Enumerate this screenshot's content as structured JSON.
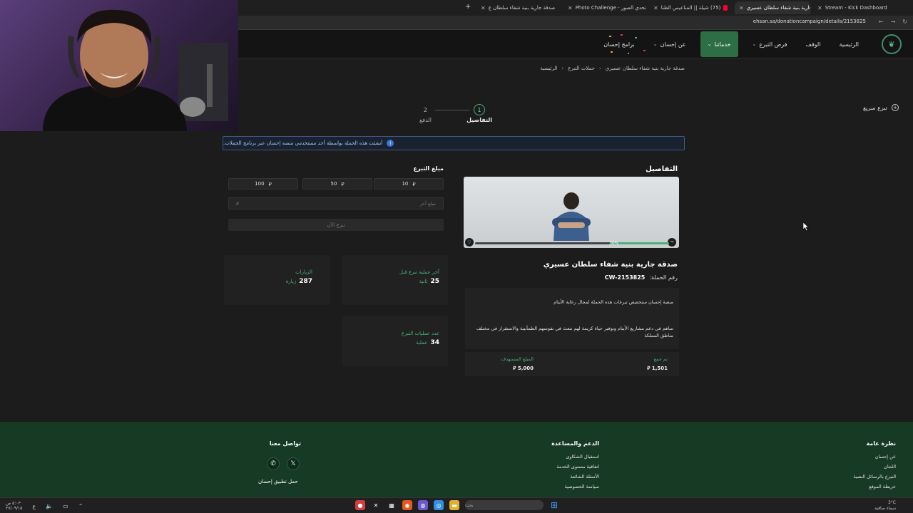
{
  "browser": {
    "tabs": [
      {
        "title": "Stream - Kick Dashboard",
        "active": false,
        "color": "#53fc18"
      },
      {
        "title": "صدقة جارية بنية شفاء سلطان عسيري",
        "active": true,
        "color": "#3f8f6a"
      },
      {
        "title": "(75) شيلة || المناعيس الطنا",
        "active": false,
        "color": "#ff0033"
      },
      {
        "title": "تحدي الصور - Photo Challenge",
        "active": false,
        "color": "#f5c518"
      },
      {
        "title": "صدقة جارية بنية شفاء سلطان ع",
        "active": false,
        "color": "#3f8f6a"
      }
    ],
    "url": "ehsan.sa/donationcampaign/details/2153825"
  },
  "nav": {
    "items": [
      {
        "label": "الرئيسية",
        "dropdown": false,
        "active": false
      },
      {
        "label": "الوقف",
        "dropdown": false,
        "active": false
      },
      {
        "label": "فرص التبرع",
        "dropdown": true,
        "active": false
      },
      {
        "label": "خدماتنا",
        "dropdown": true,
        "active": true
      },
      {
        "label": "عن إحسان",
        "dropdown": true,
        "active": false
      },
      {
        "label": "برامج إحسان",
        "dropdown": false,
        "active": false
      }
    ]
  },
  "breadcrumb": [
    "الرئيسية",
    "حملات التبرع",
    "صدقة جارية بنية شفاء سلطان عسيري"
  ],
  "quick_donate": "تبرع سريع",
  "stepper": {
    "steps": [
      {
        "num": "1",
        "label": "التفاصيل"
      },
      {
        "num": "2",
        "label": "الدفع"
      }
    ]
  },
  "banner": "أنشئت هذه الحملة بواسطة أحد مستخدمي منصة إحسان عبر برنامج الحملات.",
  "details": {
    "title": "التفاصيل",
    "progress_percent": 30,
    "progress_label": "30%",
    "campaign_name": "صدقة جارية بنية شفاء سلطان عسيري",
    "campaign_no_label": "رقم الحملة:",
    "campaign_no": "CW-2153825",
    "desc1": "منصة إحسان ستخصص تبرعات هذه الحملة لمجال رعاية الأيتام",
    "desc2": "ساهم في دعم مشاريع الأيتام وتوفير حياة كريمة لهم تبعث في نفوسهم الطمأنينة والاستقرار في مختلف مناطق المملكة",
    "collected_label": "تم جمع",
    "collected_value": "1,501",
    "target_label": "المبلغ المستهدف",
    "target_value": "5,000",
    "currency": "⃁"
  },
  "donate": {
    "title": "مبلغ التبرع",
    "amounts": [
      "10",
      "50",
      "100"
    ],
    "other_placeholder": "مبلغ آخر",
    "button": "تبرع الآن"
  },
  "stats": {
    "last_donation_label": "آخر عملية تبرع قبل",
    "last_donation_value": "25",
    "last_donation_unit": "ثانية",
    "visits_label": "الزيارات",
    "visits_value": "287",
    "visits_unit": "زيارة",
    "count_label": "عدد عمليات التبرع",
    "count_value": "34",
    "count_unit": "عملية"
  },
  "footer": {
    "overview_title": "نظرة عامة",
    "overview_links": [
      "عن إحسان",
      "اللجان",
      "التبرع بالرسائل النصية",
      "خريطة الموقع"
    ],
    "support_title": "الدعم والمساعدة",
    "support_links": [
      "استقبال الشكاوى",
      "اتفاقية مستوى الخدمة",
      "الأسئلة الشائعة",
      "سياسة الخصوصية"
    ],
    "contact_title": "تواصل معنا",
    "app_label": "حمل تطبيق إحسان"
  },
  "taskbar": {
    "search_placeholder": "بحث",
    "time": "٥:٠٣ ص",
    "date": "٢٧/٠٩/١٥",
    "weather_temp": "3°C",
    "weather_desc": "سماء صافية",
    "lang": "ع"
  }
}
